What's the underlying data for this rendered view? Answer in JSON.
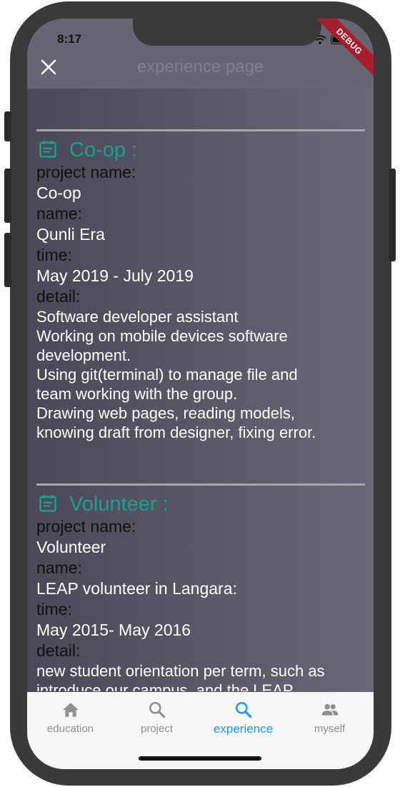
{
  "status_bar": {
    "time": "8:17"
  },
  "app_bar": {
    "title": "experience page"
  },
  "debug_banner": "DEBUG",
  "cards": [
    {
      "title": "Co-op :",
      "project_label": "project name:",
      "project_value": "Co-op",
      "name_label": "name:",
      "name_value": "Qunli Era",
      "time_label": "time:",
      "time_value": "May 2019 - July 2019",
      "detail_label": "detail:",
      "detail_lines": [
        "Software developer assistant",
        "Working on mobile devices software",
        "development.",
        "Using git(terminal) to manage file and",
        "team working with the group.",
        "Drawing web pages, reading models,",
        "knowing draft from designer, fixing error."
      ]
    },
    {
      "title": "Volunteer :",
      "project_label": "project name:",
      "project_value": "Volunteer",
      "name_label": "name:",
      "name_value": "LEAP volunteer in Langara:",
      "time_label": "time:",
      "time_value": "May 2015- May 2016",
      "detail_label": "detail:",
      "detail_lines": [
        "new student orientation per term, such as",
        "introduce our campus, and the LEAP"
      ]
    }
  ],
  "bottom_nav": {
    "active": "experience",
    "items": [
      {
        "label": "education",
        "icon": "home-icon"
      },
      {
        "label": "project",
        "icon": "search-icon"
      },
      {
        "label": "experience",
        "icon": "search-icon"
      },
      {
        "label": "myself",
        "icon": "people-icon"
      }
    ]
  },
  "colors": {
    "accent": "#18a091",
    "active_tab": "#2196f3",
    "app_bar": "#666574",
    "debug": "#a81d2d"
  }
}
